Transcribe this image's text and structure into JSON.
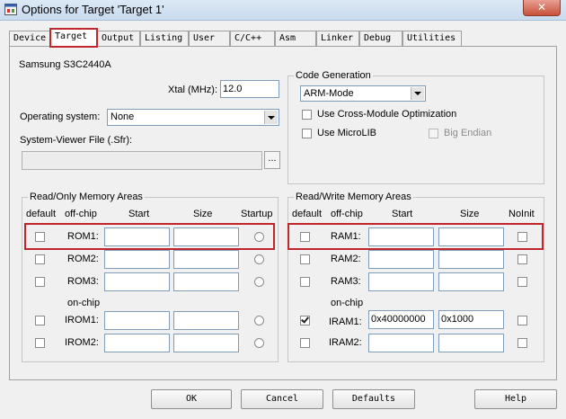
{
  "window": {
    "title": "Options for Target 'Target 1'",
    "close_label": "✕"
  },
  "tabs": [
    {
      "label": "Device"
    },
    {
      "label": "Target"
    },
    {
      "label": "Output"
    },
    {
      "label": "Listing"
    },
    {
      "label": "User"
    },
    {
      "label": "C/C++"
    },
    {
      "label": "Asm"
    },
    {
      "label": "Linker"
    },
    {
      "label": "Debug"
    },
    {
      "label": "Utilities"
    }
  ],
  "active_tab": "Target",
  "device_name": "Samsung S3C2440A",
  "xtal": {
    "label": "Xtal (MHz):",
    "value": "12.0"
  },
  "os": {
    "label": "Operating system:",
    "value": "None"
  },
  "svd": {
    "label": "System-Viewer File (.Sfr):",
    "value": "",
    "browse_label": "..."
  },
  "code_gen": {
    "title": "Code Generation",
    "mode": "ARM-Mode",
    "cross_module_label": "Use Cross-Module Optimization",
    "microlib_label": "Use MicroLIB",
    "big_endian_label": "Big Endian"
  },
  "rom_group": {
    "title": "Read/Only Memory Areas",
    "headers": {
      "default": "default",
      "offchip": "off-chip",
      "start": "Start",
      "size": "Size",
      "startup": "Startup"
    },
    "onchip_label": "on-chip",
    "rows": [
      {
        "name": "ROM1:",
        "start": "",
        "size": "",
        "checked": false
      },
      {
        "name": "ROM2:",
        "start": "",
        "size": "",
        "checked": false
      },
      {
        "name": "ROM3:",
        "start": "",
        "size": "",
        "checked": false
      },
      {
        "name": "IROM1:",
        "start": "",
        "size": "",
        "checked": false
      },
      {
        "name": "IROM2:",
        "start": "",
        "size": "",
        "checked": false
      }
    ]
  },
  "ram_group": {
    "title": "Read/Write Memory Areas",
    "headers": {
      "default": "default",
      "offchip": "off-chip",
      "start": "Start",
      "size": "Size",
      "noinit": "NoInit"
    },
    "onchip_label": "on-chip",
    "rows": [
      {
        "name": "RAM1:",
        "start": "",
        "size": "",
        "checked": false
      },
      {
        "name": "RAM2:",
        "start": "",
        "size": "",
        "checked": false
      },
      {
        "name": "RAM3:",
        "start": "",
        "size": "",
        "checked": false
      },
      {
        "name": "IRAM1:",
        "start": "0x40000000",
        "size": "0x1000",
        "checked": true
      },
      {
        "name": "IRAM2:",
        "start": "",
        "size": "",
        "checked": false
      }
    ]
  },
  "buttons": {
    "ok": "OK",
    "cancel": "Cancel",
    "defaults": "Defaults",
    "help": "Help"
  },
  "colors": {
    "highlight": "#c0262b"
  }
}
